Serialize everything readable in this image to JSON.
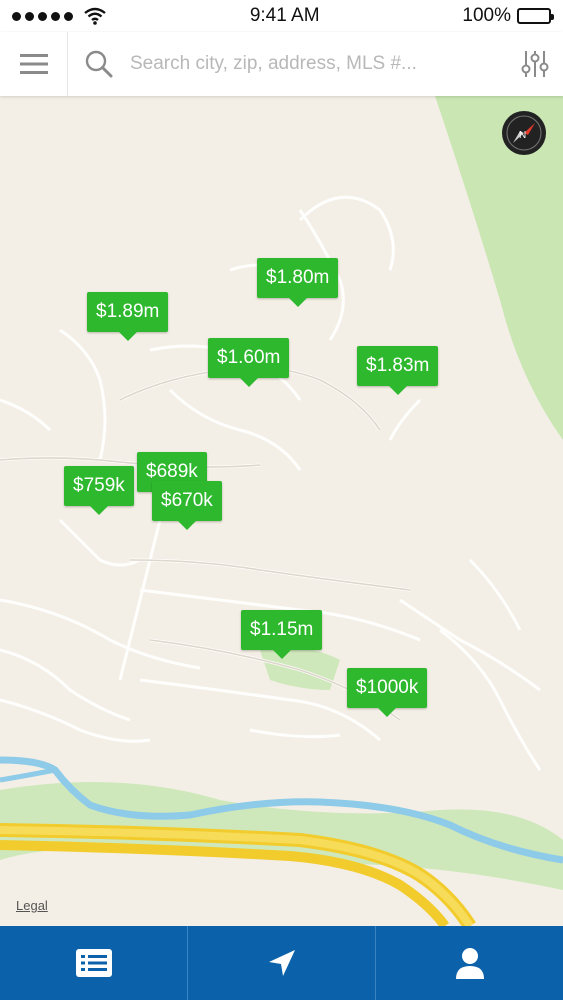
{
  "status": {
    "time": "9:41 AM",
    "battery": "100%"
  },
  "search": {
    "placeholder": "Search city, zip, address, MLS #..."
  },
  "map": {
    "legal_label": "Legal",
    "pins": [
      {
        "id": "pin-1-80m",
        "price": "$1.80m"
      },
      {
        "id": "pin-1-89m",
        "price": "$1.89m"
      },
      {
        "id": "pin-1-60m",
        "price": "$1.60m"
      },
      {
        "id": "pin-1-83m",
        "price": "$1.83m"
      },
      {
        "id": "pin-689k",
        "price": "$689k"
      },
      {
        "id": "pin-759k",
        "price": "$759k"
      },
      {
        "id": "pin-670k",
        "price": "$670k"
      },
      {
        "id": "pin-1-15m",
        "price": "$1.15m"
      },
      {
        "id": "pin-1000k",
        "price": "$1000k"
      }
    ]
  },
  "tabs": [
    {
      "icon": "list-icon"
    },
    {
      "icon": "navigation-arrow-icon"
    },
    {
      "icon": "user-icon"
    }
  ],
  "colors": {
    "pin": "#2eb82e",
    "tabbar": "#0c62aa",
    "map_bg": "#f4efe6"
  }
}
